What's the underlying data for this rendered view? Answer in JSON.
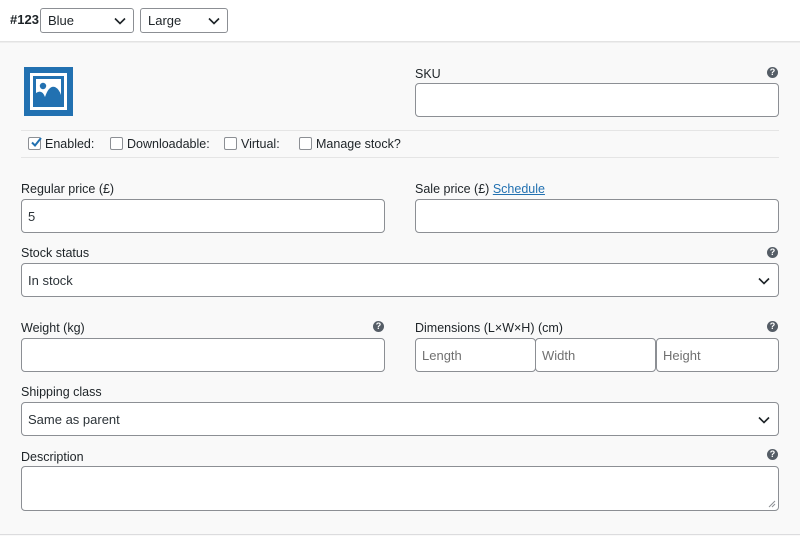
{
  "variation": {
    "id": "#123",
    "attributes": [
      {
        "value": "Blue"
      },
      {
        "value": "Large"
      }
    ]
  },
  "sku": {
    "label": "SKU",
    "value": ""
  },
  "checkboxes": [
    {
      "label": "Enabled:",
      "checked": true
    },
    {
      "label": "Downloadable:",
      "checked": false
    },
    {
      "label": "Virtual:",
      "checked": false
    },
    {
      "label": "Manage stock?",
      "checked": false
    }
  ],
  "regular_price": {
    "label": "Regular price (£)",
    "value": "5"
  },
  "sale_price": {
    "label": "Sale price (£)",
    "link": "Schedule",
    "value": ""
  },
  "stock_status": {
    "label": "Stock status",
    "value": "In stock"
  },
  "weight": {
    "label": "Weight (kg)",
    "value": ""
  },
  "dimensions": {
    "label": "Dimensions (L×W×H) (cm)",
    "length_placeholder": "Length",
    "width_placeholder": "Width",
    "height_placeholder": "Height"
  },
  "shipping_class": {
    "label": "Shipping class",
    "value": "Same as parent"
  },
  "description": {
    "label": "Description",
    "value": ""
  },
  "help_glyph": "?",
  "icons": {
    "chevron": "chevron-down-icon",
    "help": "help-icon",
    "image": "image-placeholder-icon",
    "check": "checkmark-icon"
  },
  "colors": {
    "accent": "#2271b1",
    "border": "#8c8f94",
    "panel_bg": "#f9f9f9",
    "help_bg": "#555d66"
  }
}
